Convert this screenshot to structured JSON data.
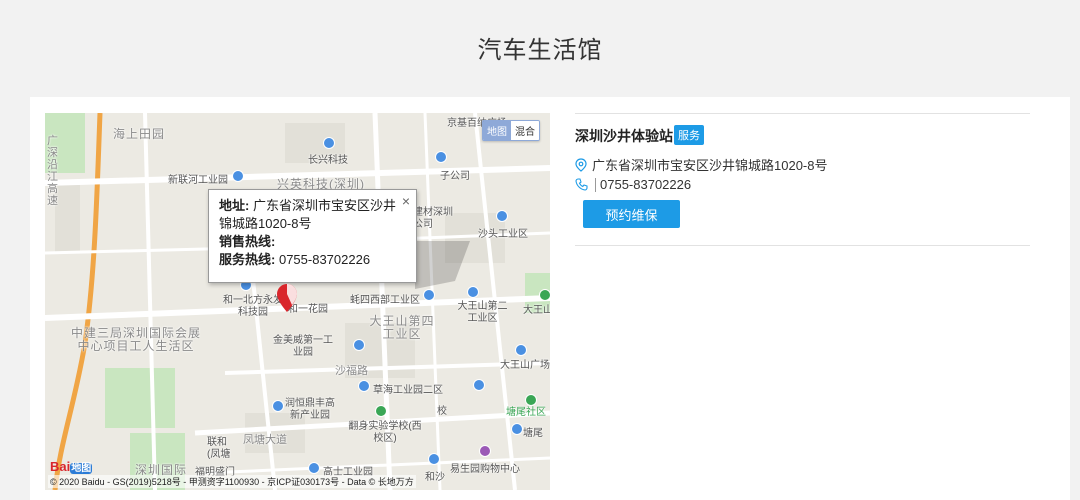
{
  "page": {
    "title": "汽车生活馆"
  },
  "map": {
    "switch": {
      "map_label": "地图",
      "hybrid_label": "混合"
    },
    "labels": {
      "haishangtian": "海上田园",
      "guangshen": "广深沿江高速",
      "changxing": "长兴科技",
      "xinlianhe": "新联河工业园",
      "xingying": "兴英科技(深圳)",
      "jinghui": "京基百纳广场",
      "zigongsi": "子公司",
      "jiancai": "建材深圳",
      "gongsi": "公司",
      "shatou": "沙头工业区",
      "heyibeifang": "和一北方永发科技园",
      "heyihuayuan": "和一花园",
      "haoqian": "蚝四西部工业区",
      "dawangshan2": "大王山第二工业区",
      "dawangshan4": "大王山第四工业区",
      "dawangshanpark": "大王山公",
      "zhongjian": "中建三局深圳国际会展中心项目工人生活区",
      "jinmeiwei": "金美威第一工业园",
      "shafu": "沙福路",
      "dawangshanplaza": "大王山广场",
      "caohai": "草海工业园二区",
      "xiao": "校",
      "tangwei": "塘尾社区",
      "tangwei2": "塘尾",
      "runheng": "润恒鼎丰高新产业园",
      "fanshen": "翻身实验学校(西校区)",
      "fengtang": "凤塘大道",
      "lianhe": "联和(凤塘",
      "shenzhenguoji": "深圳国际",
      "fuming": "福明盛门",
      "gaoshi": "高士工业园",
      "yisheng": "易生园购物中心",
      "heshan": "和沙"
    },
    "info_window": {
      "address_label": "地址:",
      "address_value": "广东省深圳市宝安区沙井锦城路1020-8号",
      "sales_label": "销售热线:",
      "sales_value": "",
      "service_label": "服务热线:",
      "service_value": "0755-83702226",
      "close": "×"
    },
    "baidu_logo": {
      "text": "Bai",
      "badge": "地图"
    },
    "attribution": "© 2020 Baidu - GS(2019)5218号 - 甲测资字1100930 - 京ICP证030173号 - Data © 长地万方"
  },
  "store": {
    "name": "深圳沙井体验站",
    "badge": "服务",
    "address": "广东省深圳市宝安区沙井锦城路1020-8号",
    "phone": "0755-83702226",
    "button": "预约维保"
  },
  "colors": {
    "accent": "#1d9be6",
    "marker": "#d9262c"
  },
  "icons": {
    "location": "location-pin-icon",
    "phone": "phone-icon",
    "close": "close-icon",
    "map_marker": "map-marker-icon"
  }
}
